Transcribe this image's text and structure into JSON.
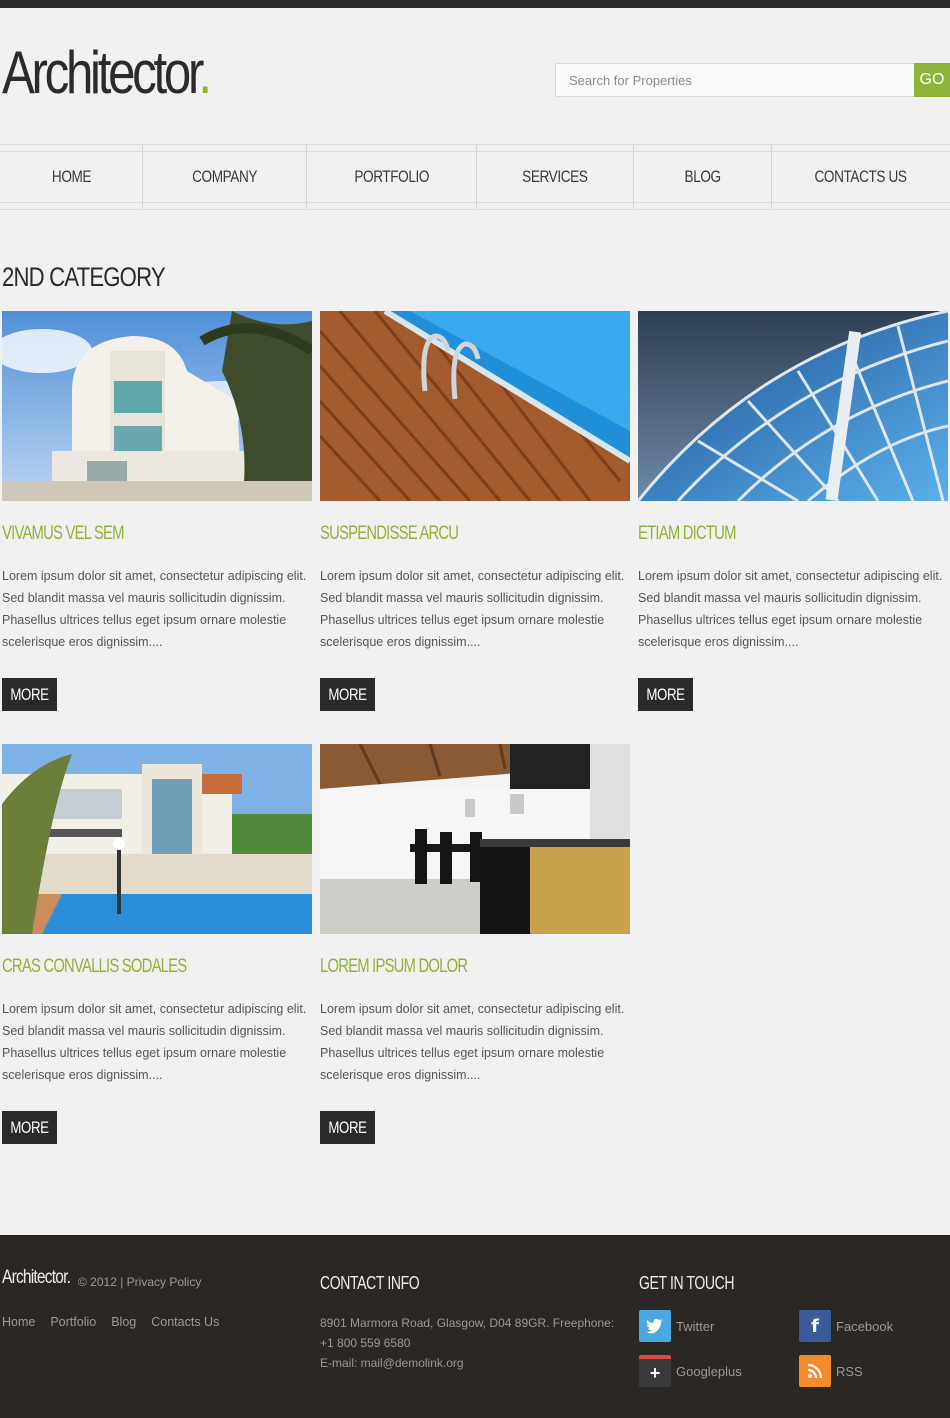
{
  "header": {
    "logo_text": "Architector",
    "logo_dot": ".",
    "search_placeholder": "Search for Properties",
    "go_label": "GO"
  },
  "nav": {
    "items": [
      {
        "label": "HOME"
      },
      {
        "label": "COMPANY"
      },
      {
        "label": "PORTFOLIO"
      },
      {
        "label": "SERVICES"
      },
      {
        "label": "BLOG"
      },
      {
        "label": "CONTACTS US"
      }
    ]
  },
  "page": {
    "title": "2ND CATEGORY"
  },
  "cards": [
    {
      "title": "VIVAMUS VEL SEM",
      "text": "Lorem ipsum dolor sit amet, consectetur adipiscing elit. Sed blandit massa vel mauris sollicitudin dignissim. Phasellus ultrices tellus eget ipsum ornare molestie scelerisque eros dignissim....",
      "more": "MORE",
      "image": "white-building-palm"
    },
    {
      "title": "SUSPENDISSE ARCU",
      "text": "Lorem ipsum dolor sit amet, consectetur adipiscing elit. Sed blandit massa vel mauris sollicitudin dignissim. Phasellus ultrices tellus eget ipsum ornare molestie scelerisque eros dignissim....",
      "more": "MORE",
      "image": "pool-deck"
    },
    {
      "title": "ETIAM DICTUM",
      "text": "Lorem ipsum dolor sit amet, consectetur adipiscing elit. Sed blandit massa vel mauris sollicitudin dignissim. Phasellus ultrices tellus eget ipsum ornare molestie scelerisque eros dignissim....",
      "more": "MORE",
      "image": "glass-roof"
    },
    {
      "title": "CRAS CONVALLIS SODALES",
      "text": "Lorem ipsum dolor sit amet, consectetur adipiscing elit. Sed blandit massa vel mauris sollicitudin dignissim. Phasellus ultrices tellus eget ipsum ornare molestie scelerisque eros dignissim....",
      "more": "MORE",
      "image": "villa-pool"
    },
    {
      "title": "LOREM IPSUM DOLOR",
      "text": "Lorem ipsum dolor sit amet, consectetur adipiscing elit. Sed blandit massa vel mauris sollicitudin dignissim. Phasellus ultrices tellus eget ipsum ornare molestie scelerisque eros dignissim....",
      "more": "MORE",
      "image": "kitchen-interior"
    }
  ],
  "footer": {
    "logo_text": "Architector.",
    "copyright": "© 2012 | Privacy Policy",
    "links": [
      "Home",
      "Portfolio",
      "Blog",
      "Contacts Us"
    ],
    "contact_heading": "CONTACT INFO",
    "contact_address": "8901 Marmora Road, Glasgow, D04 89GR. Freephone: +1 800 559 6580",
    "contact_email": "E-mail: mail@demolink.org",
    "social_heading": "GET IN TOUCH",
    "social": [
      {
        "label": "Twitter",
        "icon": "twitter-icon",
        "color": "#4aa9e0"
      },
      {
        "label": "Facebook",
        "icon": "facebook-icon",
        "color": "#3b5a9a"
      },
      {
        "label": "Googleplus",
        "icon": "googleplus-icon",
        "color": "#3a3a3a"
      },
      {
        "label": "RSS",
        "icon": "rss-icon",
        "color": "#f38b2c"
      }
    ]
  },
  "colors": {
    "accent": "#8eb43a",
    "dark": "#2a2a2a",
    "footer_bg": "#2a2725"
  }
}
